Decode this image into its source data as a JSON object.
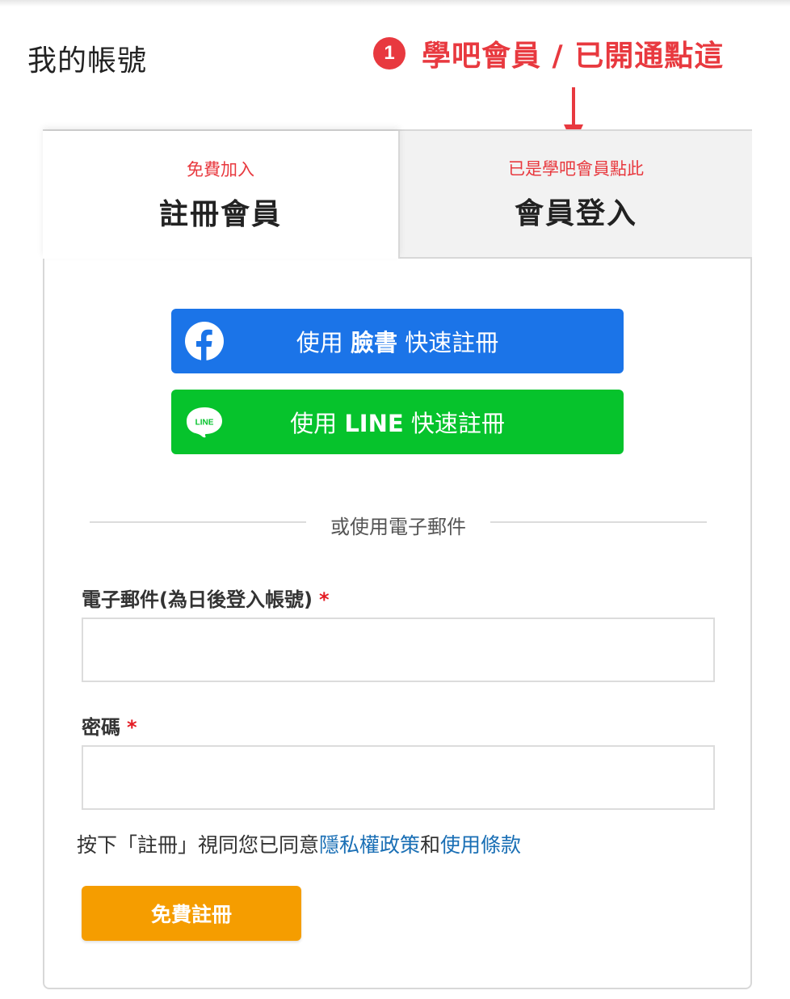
{
  "page": {
    "title": "我的帳號"
  },
  "annotation": {
    "number": "1",
    "text": "學吧會員 / 已開通點這",
    "color": "#e8393f"
  },
  "tabs": [
    {
      "sub": "免費加入",
      "main": "註冊會員",
      "active": true
    },
    {
      "sub": "已是學吧會員點此",
      "main": "會員登入",
      "active": false
    }
  ],
  "social": {
    "facebook": {
      "pre": "使用 ",
      "brand": "臉書",
      "post": " 快速註冊",
      "color": "#1b74e8",
      "icon": "facebook-icon"
    },
    "line": {
      "pre": "使用 ",
      "brand": "LINE",
      "post": " 快速註冊",
      "icon_text": "LINE",
      "color": "#06c32c",
      "icon": "line-icon"
    }
  },
  "divider": {
    "text": "或使用電子郵件"
  },
  "form": {
    "email_label": "電子郵件(為日後登入帳號)",
    "password_label": "密碼",
    "required_mark": "*",
    "email_value": "",
    "password_value": ""
  },
  "terms": {
    "before": "按下「註冊」視同您已同意",
    "privacy_link": "隱私權政策",
    "middle": "和",
    "tos_link": "使用條款"
  },
  "submit": {
    "label": "免費註冊",
    "color": "#f59d00"
  }
}
